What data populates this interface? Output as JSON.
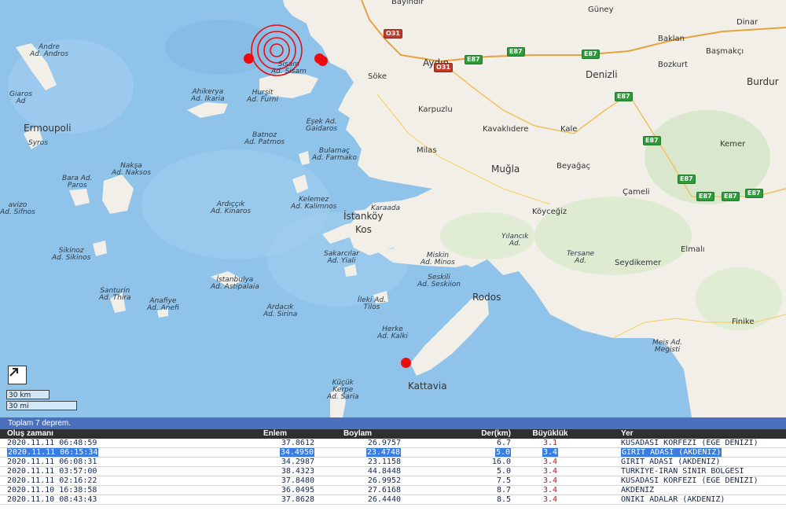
{
  "map": {
    "labels": {
      "bayindir": "Bayındır",
      "guney": "Güney",
      "dinar": "Dinar",
      "baklan": "Baklan",
      "bozkurt": "Bozkurt",
      "basmakci": "Başmakçı",
      "burdur": "Burdur",
      "denizli": "Denizli",
      "aydin": "Aydın",
      "soke": "Söke",
      "karpuzlu": "Karpuzlu",
      "kavaklidere": "Kavaklıdere",
      "kale": "Kale",
      "kemer": "Kemer",
      "milas": "Milas",
      "mugla": "Muğla",
      "beyagac": "Beyağaç",
      "cameli": "Çameli",
      "koycegiz": "Köyceğiz",
      "elmali": "Elmalı",
      "seydikemer": "Seydikemer",
      "finike": "Finike",
      "istankoy": "İstanköy",
      "kos": "Kos",
      "rodos": "Rodos",
      "kattavia": "Kattavia",
      "ermoupoli": "Ermoupoli",
      "karaada": "Karaada",
      "andros": [
        "Andre",
        "Ad. Andros"
      ],
      "giaros": [
        "Giaros",
        "Ad"
      ],
      "syros": "Syros",
      "ahikerya": [
        "Ahikerya",
        "Ad. Ikaria"
      ],
      "hursit": [
        "Hurşit",
        "Ad. Furni"
      ],
      "samos": [
        "Sisam",
        "Ad. Sisam"
      ],
      "batnoz": [
        "Batnoz",
        "Ad. Patmos"
      ],
      "esek": [
        "Eşek Ad.",
        "Gaidaros"
      ],
      "bulamac": [
        "Bulamaç",
        "Ad. Farmako"
      ],
      "naksa": [
        "Nakşa",
        "Ad. Naksos"
      ],
      "bara": [
        "Bara Ad.",
        "Paros"
      ],
      "ardiccik": [
        "Ardıççık",
        "Ad. Kinaros"
      ],
      "kelemez": [
        "Kelemez",
        "Ad. Kalimnos"
      ],
      "sifnos": [
        "avizo",
        "Ad. Sifnos"
      ],
      "sikinos": [
        "Sikinoz",
        "Ad. Sikinos"
      ],
      "istanbulya": [
        "İstanbulya",
        "Ad. Astipalaia"
      ],
      "sakarcilar": [
        "Sakarcılar",
        "Ad. Yiali"
      ],
      "miskin": [
        "Miskin",
        "Ad. Minos"
      ],
      "seskili": [
        "Seskili",
        "Ad. Seskiion"
      ],
      "yilancik": [
        "Yılancık",
        "Ad."
      ],
      "tersane": [
        "Tersane",
        "Ad."
      ],
      "santurin": [
        "Santurin",
        "Ad. Thira"
      ],
      "anafiye": [
        "Anafiye",
        "Ad. Anefi"
      ],
      "ardacik": [
        "Ardacık",
        "Ad. Sirina"
      ],
      "ileki": [
        "İleki Ad.",
        "Tilos"
      ],
      "herke": [
        "Herke",
        "Ad. Kalki"
      ],
      "kucuk": [
        "Küçük",
        "Kerpe",
        "Ad. Saria"
      ],
      "meis": [
        "Meis Ad.",
        "Megisti"
      ]
    },
    "roads": {
      "o31a": "O31",
      "o31b": "O31",
      "e87a": "E87",
      "e87b": "E87",
      "e87c": "E87",
      "e87d": "E87",
      "e87e": "E87",
      "e87f": "E87",
      "e87g": "E87",
      "e87h": "E87",
      "e87i": "E87"
    },
    "scale": {
      "km": "30 km",
      "mi": "30 mi"
    },
    "colors": {
      "sea": "#8fc3ea",
      "land": "#f2efe8",
      "quake": "#ec0c10"
    }
  },
  "panel": {
    "summary": "Toplam 7 deprem.",
    "columns": {
      "time": "Oluş zamanı",
      "lat": "Enlem",
      "lon": "Boylam",
      "depth": "Der(km)",
      "mag": "Büyüklük",
      "place": "Yer"
    },
    "rows": [
      {
        "time": "2020.11.11 06:48:59",
        "lat": "37.8612",
        "lon": "26.9757",
        "depth": "6.7",
        "mag": "3.1",
        "place": "KUSADASI KORFEZI (EGE DENIZI)"
      },
      {
        "time": "2020.11.11 06:15:34",
        "lat": "34.4950",
        "lon": "23.4748",
        "depth": "5.0",
        "mag": "3.4",
        "place": "GIRIT ADASI (AKDENIZ)"
      },
      {
        "time": "2020.11.11 06:08:31",
        "lat": "34.2987",
        "lon": "23.1158",
        "depth": "16.0",
        "mag": "3.4",
        "place": "GIRIT ADASI (AKDENIZ)"
      },
      {
        "time": "2020.11.11 03:57:00",
        "lat": "38.4323",
        "lon": "44.8448",
        "depth": "5.0",
        "mag": "3.4",
        "place": "TURKIYE-IRAN SINIR BOLGESI"
      },
      {
        "time": "2020.11.11 02:16:22",
        "lat": "37.8480",
        "lon": "26.9952",
        "depth": "7.5",
        "mag": "3.4",
        "place": "KUSADASI KORFEZI (EGE DENIZI)"
      },
      {
        "time": "2020.11.10 16:38:58",
        "lat": "36.0495",
        "lon": "27.6168",
        "depth": "8.7",
        "mag": "3.4",
        "place": "AKDENIZ"
      },
      {
        "time": "2020.11.10 08:43:43",
        "lat": "37.8628",
        "lon": "26.4440",
        "depth": "8.5",
        "mag": "3.4",
        "place": "ONIKI ADALAR (AKDENIZ)"
      }
    ]
  }
}
